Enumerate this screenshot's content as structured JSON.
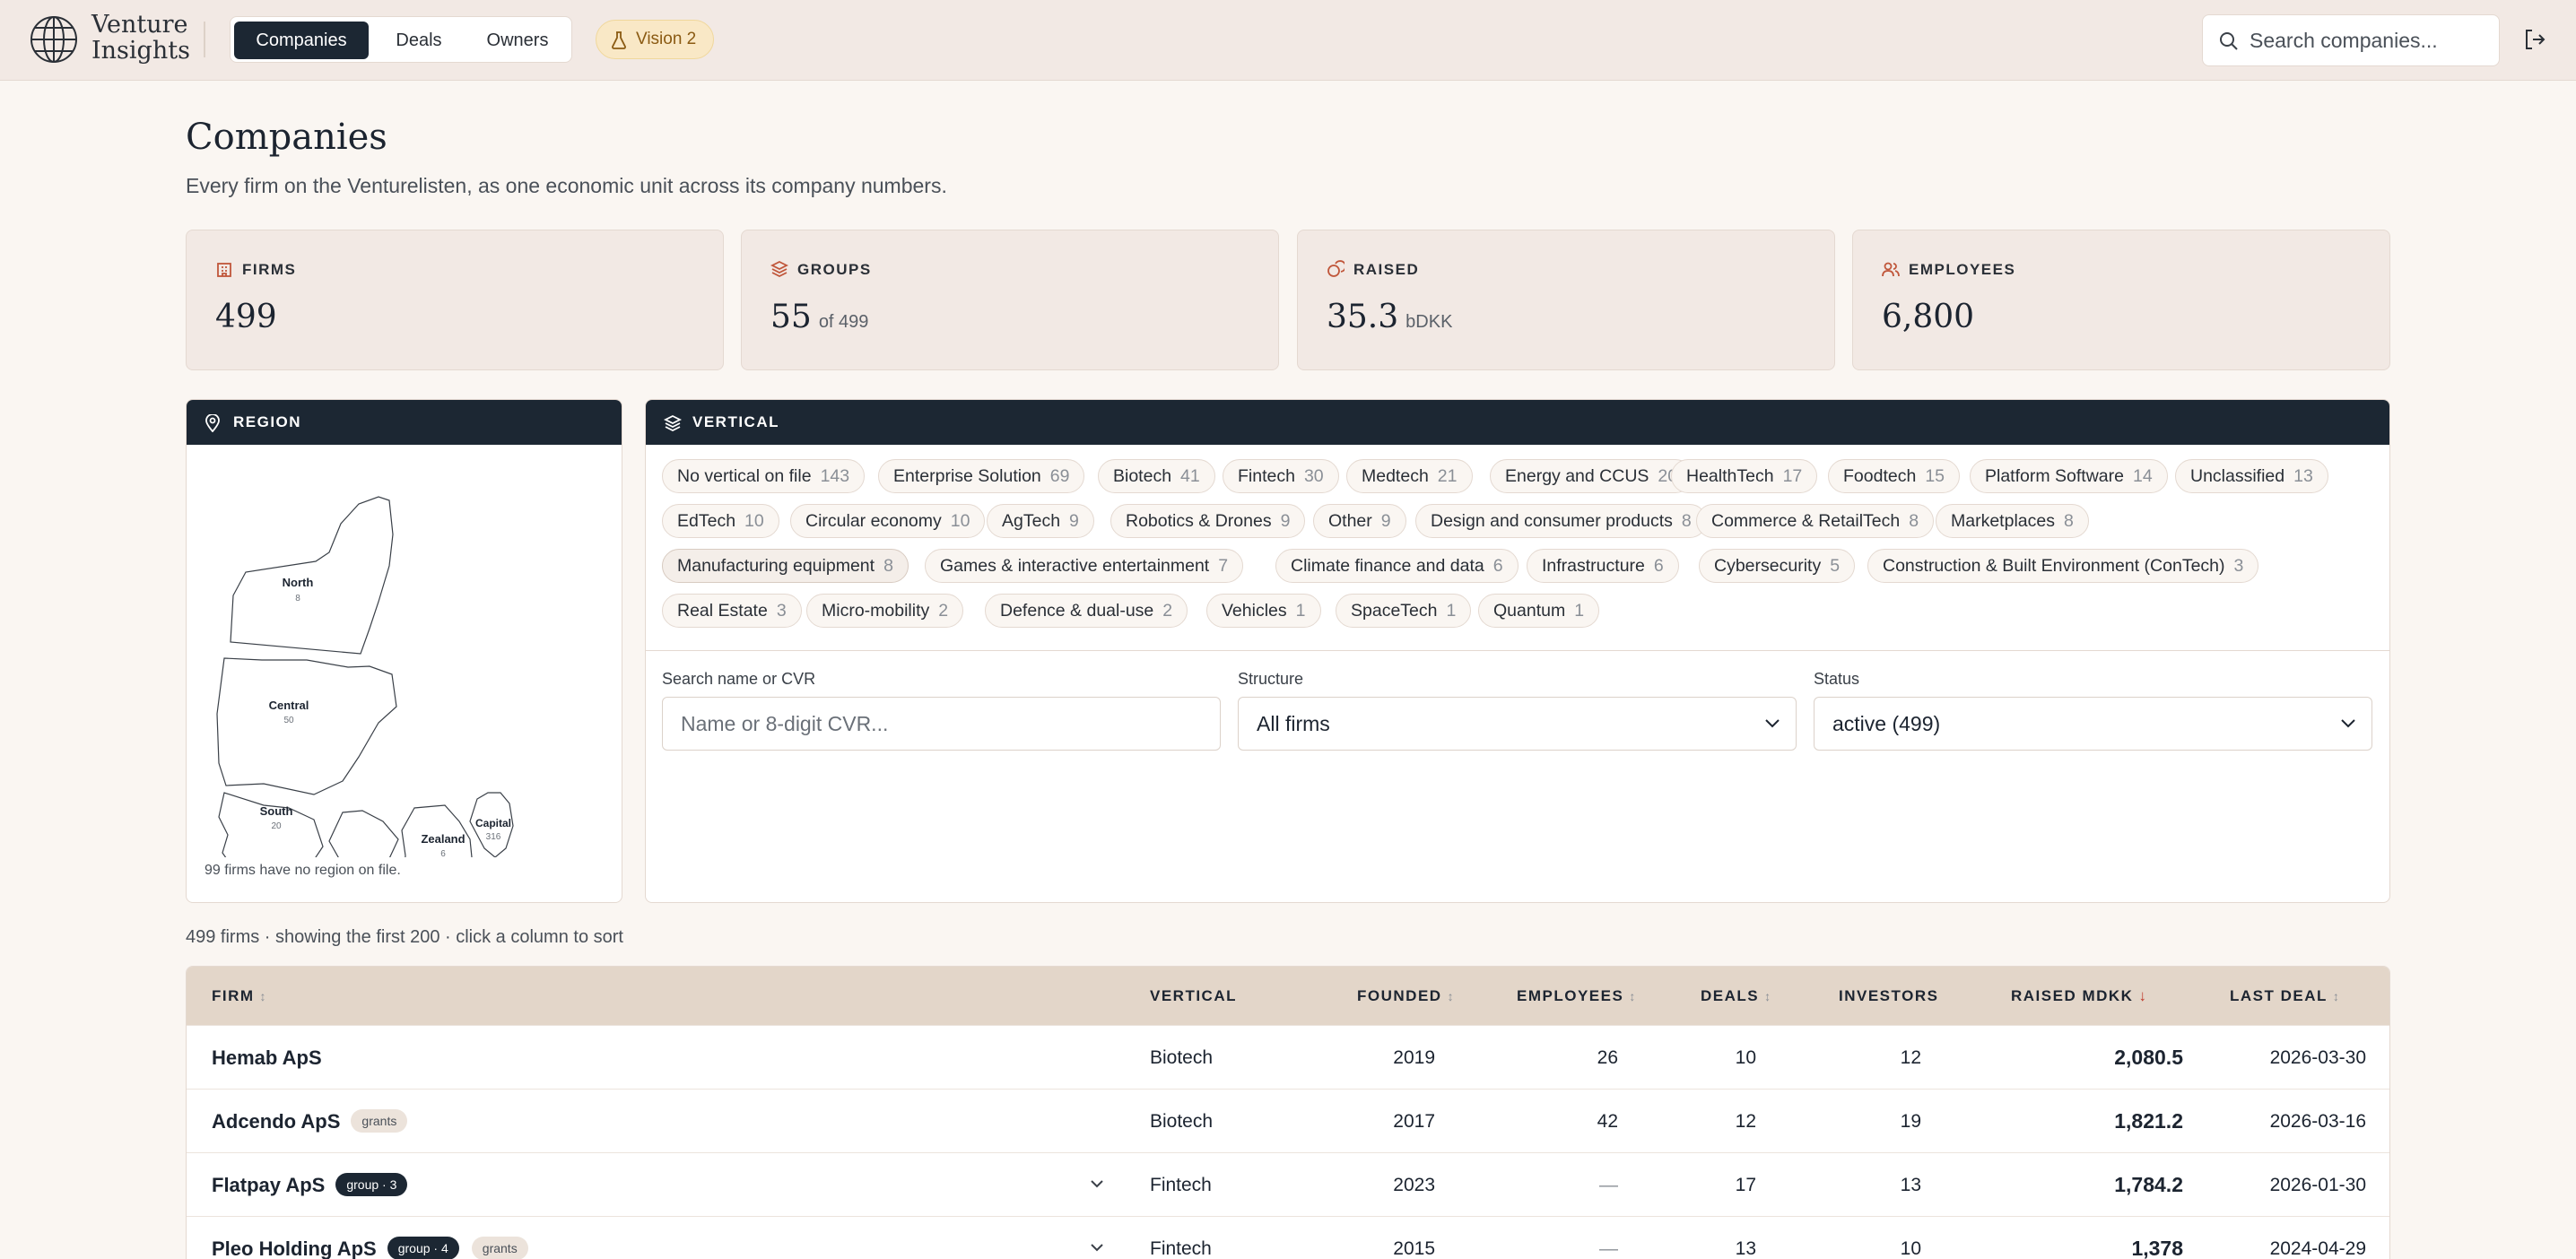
{
  "brand": {
    "name_line1": "Venture",
    "name_line2": "Insights"
  },
  "nav": {
    "tabs": [
      "Companies",
      "Deals",
      "Owners"
    ],
    "active": "Companies"
  },
  "vision_badge": "Vision 2",
  "global_search": {
    "placeholder": "Search companies..."
  },
  "page": {
    "title": "Companies",
    "subtitle": "Every firm on the Venturelisten, as one economic unit across its company numbers."
  },
  "stats": [
    {
      "label": "FIRMS",
      "value": "499",
      "sub": ""
    },
    {
      "label": "GROUPS",
      "value": "55",
      "sub": "of 499"
    },
    {
      "label": "RAISED",
      "value": "35.3",
      "sub": "bDKK"
    },
    {
      "label": "EMPLOYEES",
      "value": "6,800",
      "sub": ""
    }
  ],
  "region": {
    "title": "REGION",
    "regions": [
      {
        "name": "North",
        "count": "8"
      },
      {
        "name": "Central",
        "count": "50"
      },
      {
        "name": "South",
        "count": "20"
      },
      {
        "name": "Zealand",
        "count": "6"
      },
      {
        "name": "Capital",
        "count": "316"
      }
    ],
    "note": "99 firms have no region on file."
  },
  "vertical": {
    "title": "VERTICAL",
    "chips": [
      {
        "label": "No vertical on file",
        "count": "143"
      },
      {
        "label": "Enterprise Solution",
        "count": "69"
      },
      {
        "label": "Biotech",
        "count": "41"
      },
      {
        "label": "Fintech",
        "count": "30"
      },
      {
        "label": "Medtech",
        "count": "21"
      },
      {
        "label": "Energy and CCUS",
        "count": "20"
      },
      {
        "label": "HealthTech",
        "count": "17"
      },
      {
        "label": "Foodtech",
        "count": "15"
      },
      {
        "label": "Platform Software",
        "count": "14"
      },
      {
        "label": "Unclassified",
        "count": "13"
      },
      {
        "label": "EdTech",
        "count": "10"
      },
      {
        "label": "Circular economy",
        "count": "10"
      },
      {
        "label": "AgTech",
        "count": "9"
      },
      {
        "label": "Robotics & Drones",
        "count": "9"
      },
      {
        "label": "Other",
        "count": "9"
      },
      {
        "label": "Design and consumer products",
        "count": "8"
      },
      {
        "label": "Commerce & RetailTech",
        "count": "8"
      },
      {
        "label": "Marketplaces",
        "count": "8"
      },
      {
        "label": "Manufacturing equipment",
        "count": "8"
      },
      {
        "label": "Games & interactive entertainment",
        "count": "7"
      },
      {
        "label": "Climate finance and data",
        "count": "6"
      },
      {
        "label": "Infrastructure",
        "count": "6"
      },
      {
        "label": "Cybersecurity",
        "count": "5"
      },
      {
        "label": "Construction & Built Environment (ConTech)",
        "count": "3"
      },
      {
        "label": "Real Estate",
        "count": "3"
      },
      {
        "label": "Micro-mobility",
        "count": "2"
      },
      {
        "label": "Defence & dual-use",
        "count": "2"
      },
      {
        "label": "Vehicles",
        "count": "1"
      },
      {
        "label": "SpaceTech",
        "count": "1"
      },
      {
        "label": "Quantum",
        "count": "1"
      }
    ],
    "selected": "Manufacturing equipment"
  },
  "filters": {
    "search_label": "Search name or CVR",
    "search_placeholder": "Name or 8-digit CVR...",
    "structure_label": "Structure",
    "structure_value": "All firms",
    "status_label": "Status",
    "status_value": "active (499)"
  },
  "table": {
    "note": "499 firms · showing the first 200 · click a column to sort",
    "columns": [
      "FIRM",
      "VERTICAL",
      "FOUNDED",
      "EMPLOYEES",
      "DEALS",
      "INVESTORS",
      "RAISED MDKK",
      "LAST DEAL"
    ],
    "sort_column": "RAISED MDKK",
    "rows": [
      {
        "firm": "Hemab ApS",
        "badges": [],
        "vertical": "Biotech",
        "founded": "2019",
        "employees": "26",
        "deals": "10",
        "investors": "12",
        "raised": "2,080.5",
        "last_deal": "2026-03-30",
        "expandable": false
      },
      {
        "firm": "Adcendo ApS",
        "badges": [
          "grants"
        ],
        "vertical": "Biotech",
        "founded": "2017",
        "employees": "42",
        "deals": "12",
        "investors": "19",
        "raised": "1,821.2",
        "last_deal": "2026-03-16",
        "expandable": false
      },
      {
        "firm": "Flatpay ApS",
        "badges": [
          "group · 3"
        ],
        "vertical": "Fintech",
        "founded": "2023",
        "employees": "—",
        "deals": "17",
        "investors": "13",
        "raised": "1,784.2",
        "last_deal": "2026-01-30",
        "expandable": true
      },
      {
        "firm": "Pleo Holding ApS",
        "badges": [
          "group · 4",
          "grants"
        ],
        "vertical": "Fintech",
        "founded": "2015",
        "employees": "—",
        "deals": "13",
        "investors": "10",
        "raised": "1,378",
        "last_deal": "2024-04-29",
        "expandable": true
      }
    ]
  }
}
